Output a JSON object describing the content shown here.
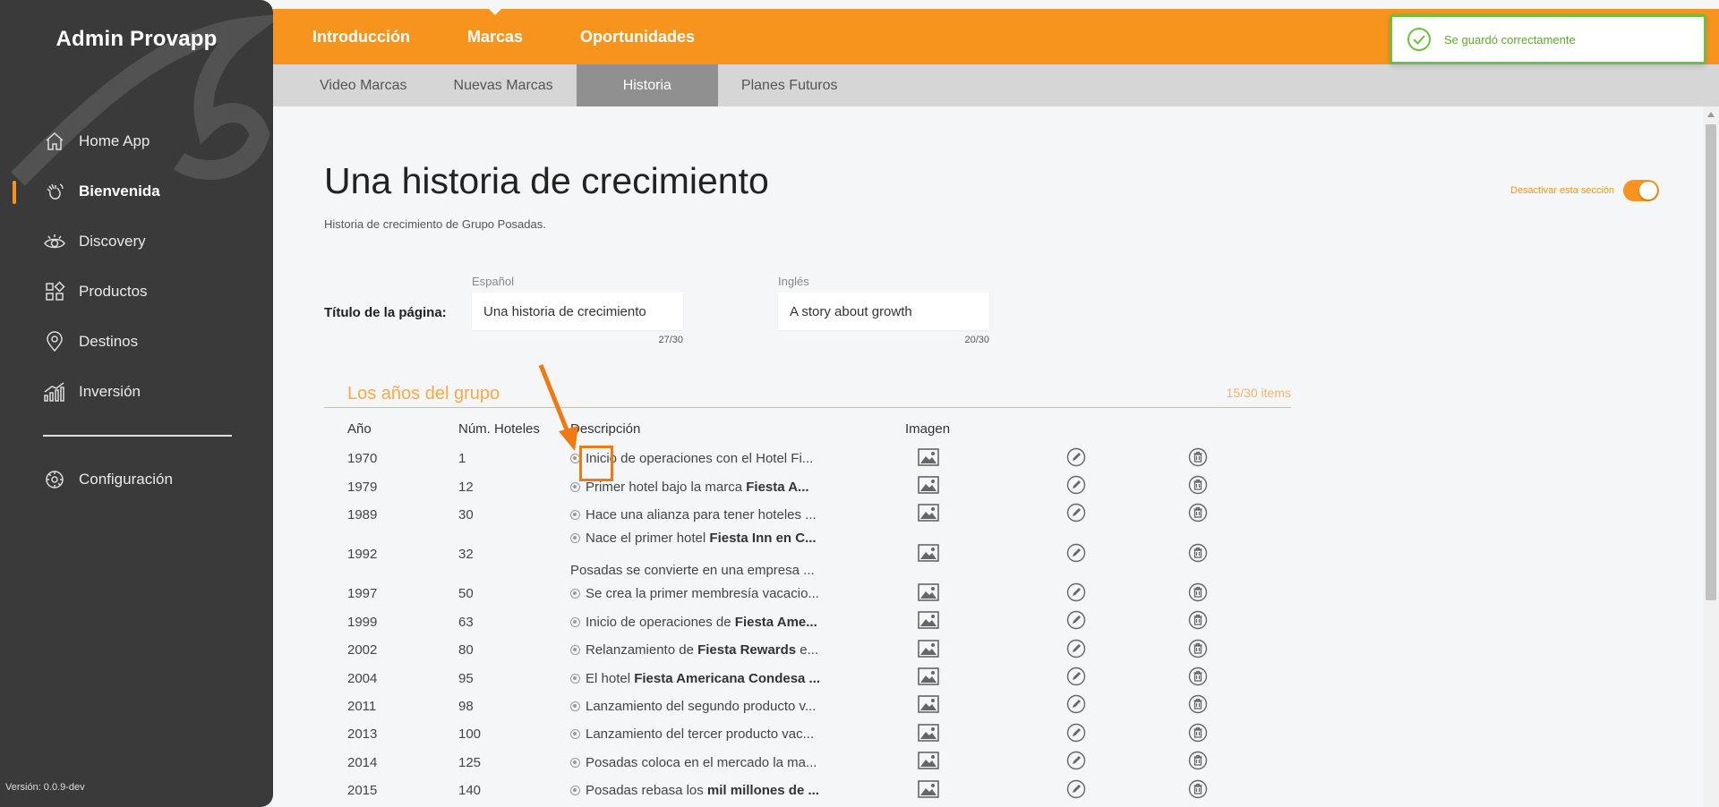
{
  "sidebar": {
    "brand": "Admin Provapp",
    "items": [
      {
        "label": "Home App",
        "icon": "home-icon"
      },
      {
        "label": "Bienvenida",
        "icon": "hand-wave-icon",
        "active": true
      },
      {
        "label": "Discovery",
        "icon": "eye-icon"
      },
      {
        "label": "Productos",
        "icon": "grid-icon"
      },
      {
        "label": "Destinos",
        "icon": "location-pin-icon"
      },
      {
        "label": "Inversión",
        "icon": "bar-chart-icon"
      }
    ],
    "config": {
      "label": "Configuración",
      "icon": "gear-icon"
    },
    "version": "Versión: 0.0.9-dev"
  },
  "top_tabs": [
    {
      "label": "Introducción"
    },
    {
      "label": "Marcas",
      "active": true
    },
    {
      "label": "Oportunidades"
    }
  ],
  "sub_tabs": [
    {
      "label": "Video Marcas"
    },
    {
      "label": "Nuevas Marcas"
    },
    {
      "label": "Historia",
      "active": true
    },
    {
      "label": "Planes Futuros"
    }
  ],
  "toast": {
    "message": "Se guardó correctamente"
  },
  "page": {
    "title": "Una historia de crecimiento",
    "subtitle": "Historia de crecimiento de Grupo Posadas.",
    "toggle_label": "Desactivar esta sección",
    "title_field_label": "Título de la página:",
    "spanish": {
      "label": "Español",
      "value": "Una historia de crecimiento",
      "count": "27/30"
    },
    "english": {
      "label": "Inglés",
      "value": "A story about growth",
      "count": "20/30"
    }
  },
  "section": {
    "title": "Los años del grupo",
    "count": "15/30 items"
  },
  "table": {
    "headers": {
      "year": "Año",
      "hotels": "Núm. Hoteles",
      "description": "Descripción",
      "image": "Imagen"
    },
    "rows": [
      {
        "year": "1970",
        "hotels": "1",
        "desc": [
          {
            "t": "Inicio de operaciones con el Hotel Fi..."
          }
        ]
      },
      {
        "year": "1979",
        "hotels": "12",
        "desc": [
          {
            "t": "Primer hotel bajo la marca "
          },
          {
            "t": "Fiesta A...",
            "b": true
          }
        ]
      },
      {
        "year": "1989",
        "hotels": "30",
        "desc": [
          {
            "t": "Hace una alianza para tener hoteles ..."
          }
        ]
      },
      {
        "year": "1992",
        "hotels": "32",
        "desc": [
          {
            "t": "Nace el primer hotel "
          },
          {
            "t": "Fiesta Inn en C...",
            "b": true
          }
        ],
        "desc2": "Posadas se convierte en una empresa ..."
      },
      {
        "year": "1997",
        "hotels": "50",
        "desc": [
          {
            "t": "Se crea la primer membresía vacacio..."
          }
        ]
      },
      {
        "year": "1999",
        "hotels": "63",
        "desc": [
          {
            "t": "Inicio de operaciones de "
          },
          {
            "t": "Fiesta Ame...",
            "b": true
          }
        ]
      },
      {
        "year": "2002",
        "hotels": "80",
        "desc": [
          {
            "t": "Relanzamiento de "
          },
          {
            "t": "Fiesta Rewards",
            "b": true
          },
          {
            "t": " e..."
          }
        ]
      },
      {
        "year": "2004",
        "hotels": "95",
        "desc": [
          {
            "t": "El hotel "
          },
          {
            "t": "Fiesta Americana Condesa ...",
            "b": true
          }
        ]
      },
      {
        "year": "2011",
        "hotels": "98",
        "desc": [
          {
            "t": "Lanzamiento del segundo producto v..."
          }
        ]
      },
      {
        "year": "2013",
        "hotels": "100",
        "desc": [
          {
            "t": "Lanzamiento del tercer producto vac..."
          }
        ]
      },
      {
        "year": "2014",
        "hotels": "125",
        "desc": [
          {
            "t": "Posadas coloca en el mercado la ma..."
          }
        ]
      },
      {
        "year": "2015",
        "hotels": "140",
        "desc": [
          {
            "t": "Posadas rebasa los "
          },
          {
            "t": "mil millones de ...",
            "b": true
          }
        ]
      }
    ]
  },
  "colors": {
    "accent": "#f7941d",
    "sidebar": "#3a3a3a",
    "success": "#6dbf3f",
    "annotation": "#f07a12"
  }
}
